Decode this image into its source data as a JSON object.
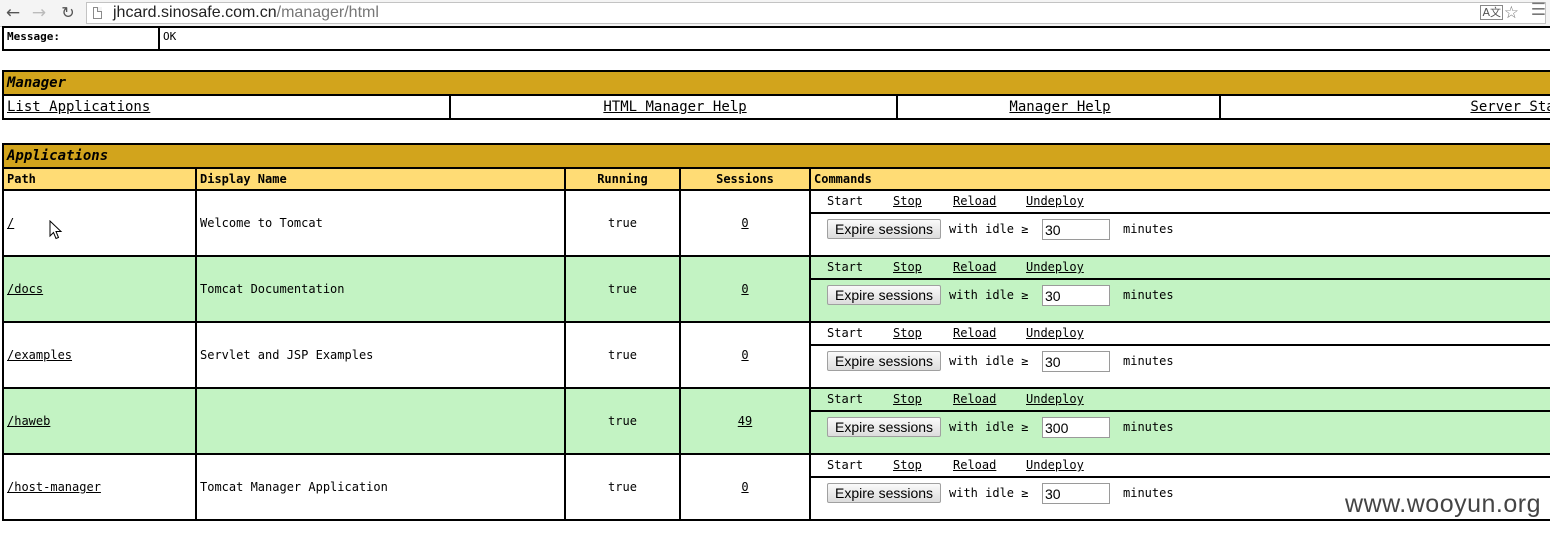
{
  "browser": {
    "url_host": "jhcard.sinosafe.com.cn",
    "url_path": "/manager/html",
    "back_icon": "arrow-left-icon",
    "forward_icon": "arrow-right-icon",
    "reload_icon": "reload-icon"
  },
  "message": {
    "label": "Message:",
    "value": "OK"
  },
  "manager": {
    "title": "Manager",
    "links": [
      "List Applications",
      "HTML Manager Help",
      "Manager Help",
      "Server Status"
    ]
  },
  "applications": {
    "title": "Applications",
    "columns": [
      "Path",
      "Display Name",
      "Running",
      "Sessions",
      "Commands"
    ],
    "command_labels": {
      "start": "Start",
      "stop": "Stop",
      "reload": "Reload",
      "undeploy": "Undeploy"
    },
    "expire_label": "Expire sessions",
    "idle_label": "with idle ≥",
    "minutes_label": "minutes",
    "rows": [
      {
        "path": "/",
        "display_name": "Welcome to Tomcat",
        "running": "true",
        "sessions": "0",
        "idle": "30"
      },
      {
        "path": "/docs",
        "display_name": "Tomcat Documentation",
        "running": "true",
        "sessions": "0",
        "idle": "30"
      },
      {
        "path": "/examples",
        "display_name": "Servlet and JSP Examples",
        "running": "true",
        "sessions": "0",
        "idle": "30"
      },
      {
        "path": "/haweb",
        "display_name": "",
        "running": "true",
        "sessions": "49",
        "idle": "300"
      },
      {
        "path": "/host-manager",
        "display_name": "Tomcat Manager Application",
        "running": "true",
        "sessions": "0",
        "idle": "30"
      }
    ]
  },
  "watermark": "www.wooyun.org"
}
